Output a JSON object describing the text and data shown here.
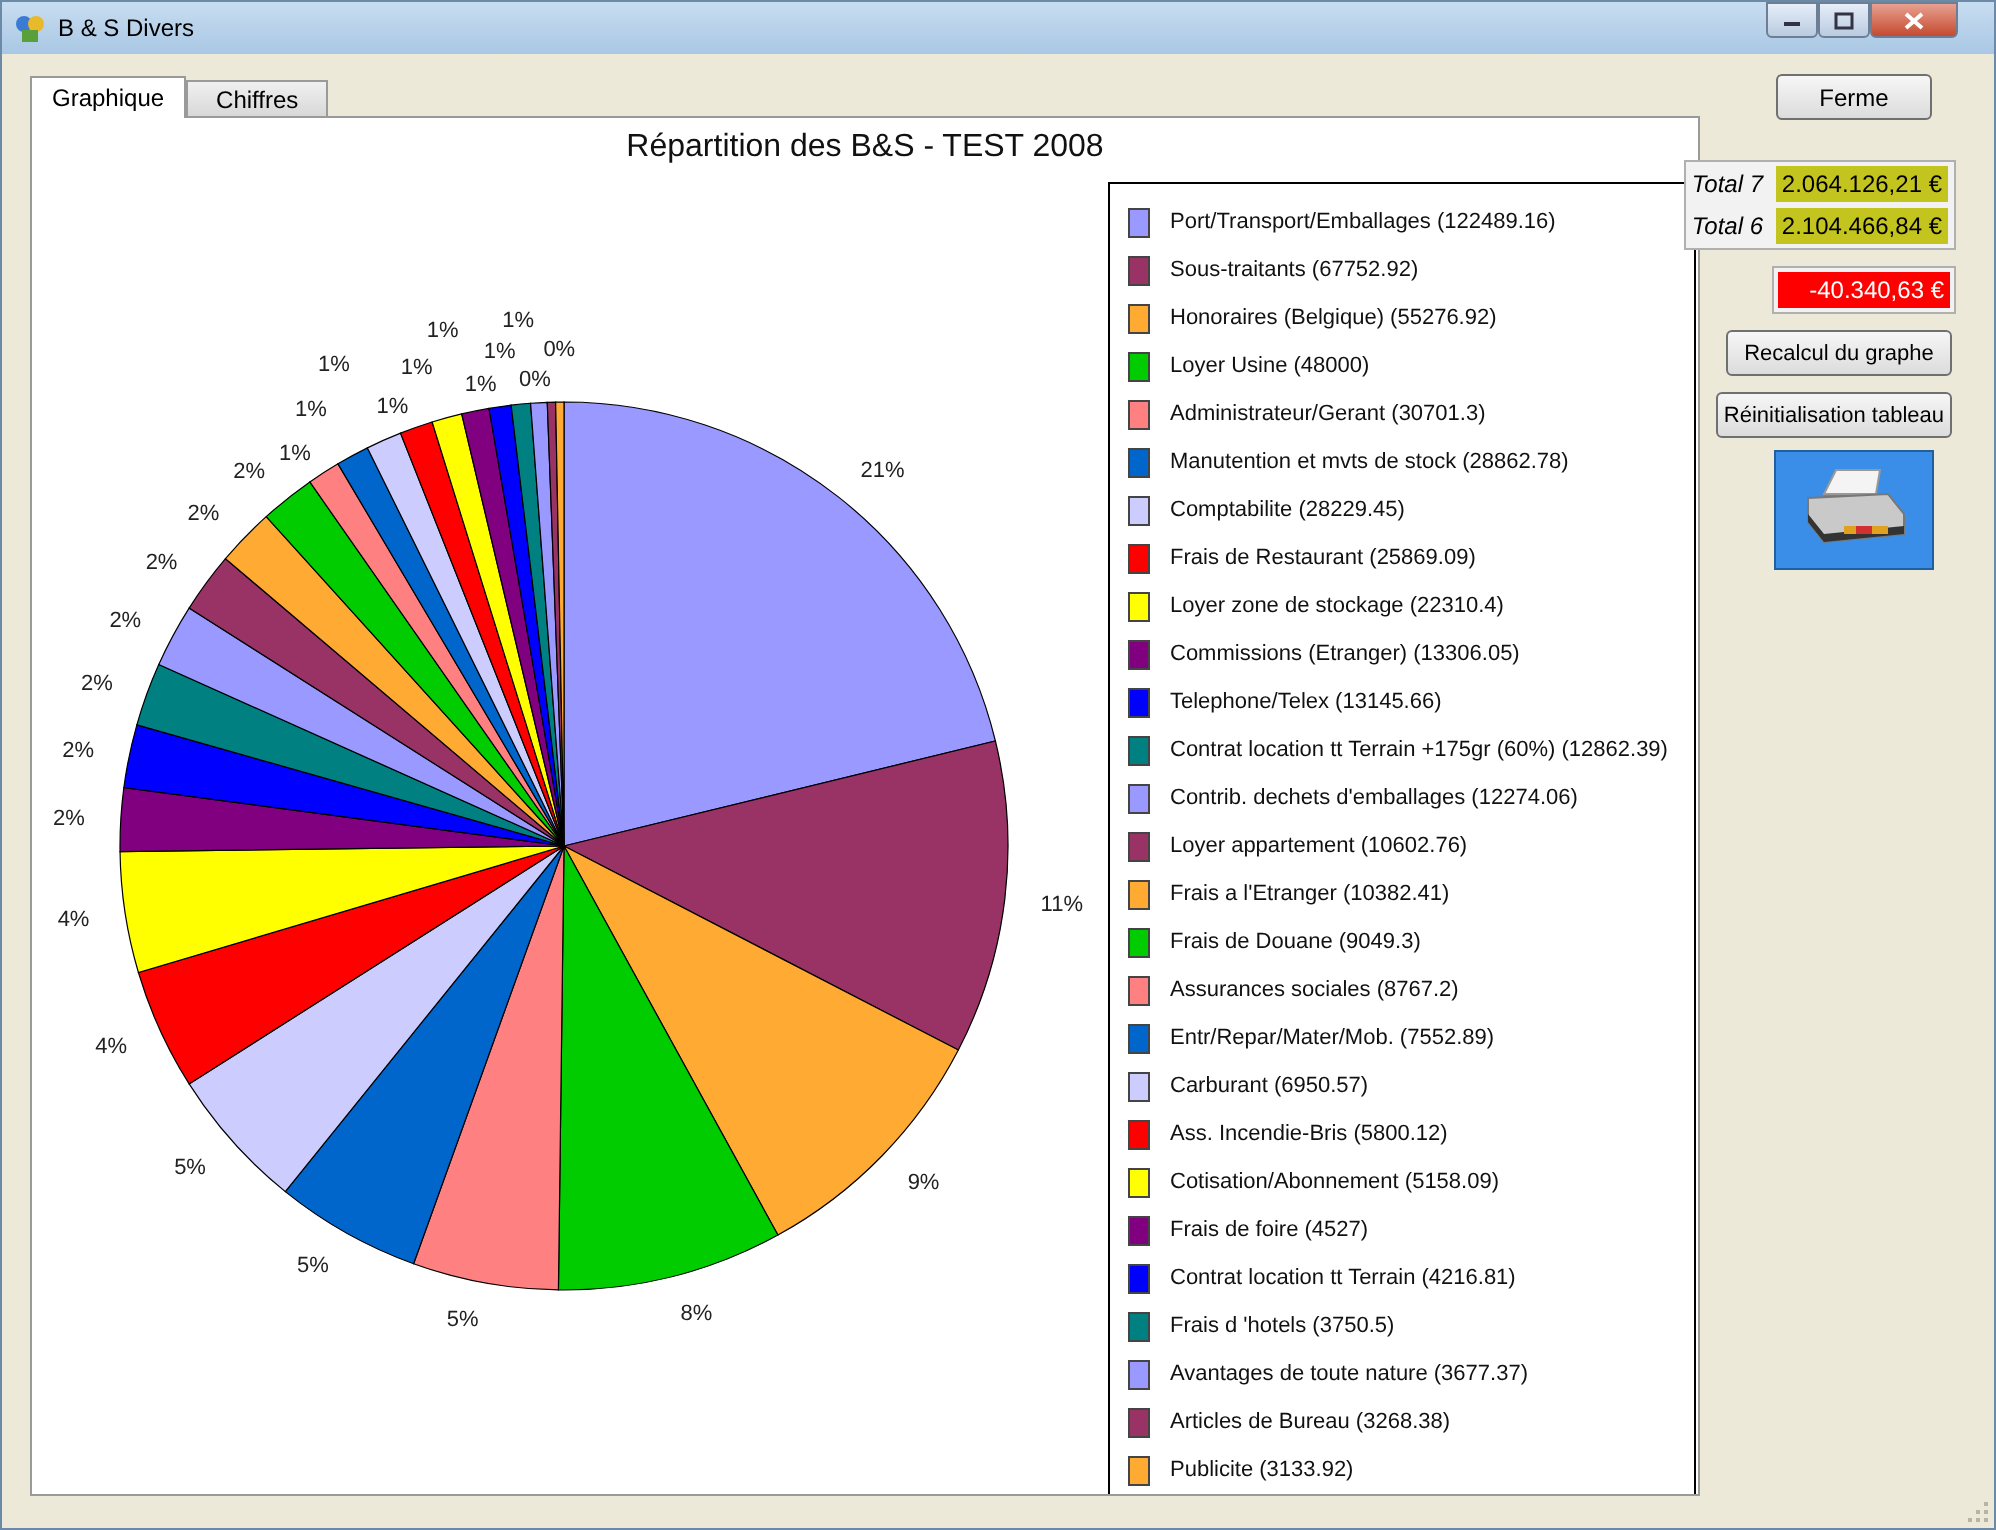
{
  "window": {
    "title": "B & S Divers"
  },
  "tabs": [
    {
      "label": "Graphique",
      "selected": true
    },
    {
      "label": "Chiffres",
      "selected": false
    }
  ],
  "chart_data": {
    "type": "pie",
    "title": "Répartition des B&S - TEST 2008",
    "categories": [
      "Port/Transport/Emballages (122489.16)",
      "Sous-traitants (67752.92)",
      "Honoraires (Belgique) (55276.92)",
      "Loyer Usine (48000)",
      "Administrateur/Gerant (30701.3)",
      "Manutention et mvts de stock (28862.78)",
      "Comptabilite (28229.45)",
      "Frais de Restaurant (25869.09)",
      "Loyer zone de stockage (22310.4)",
      "Commissions (Etranger) (13306.05)",
      "Telephone/Telex (13145.66)",
      "Contrat location tt Terrain +175gr (60%) (12862.39)",
      "Contrib. dechets d'emballages (12274.06)",
      "Loyer appartement (10602.76)",
      "Frais a l'Etranger (10382.41)",
      "Frais de Douane (9049.3)",
      "Assurances sociales (8767.2)",
      "Entr/Repar/Mater/Mob. (7552.89)",
      "Carburant (6950.57)",
      "Ass. Incendie-Bris (5800.12)",
      "Cotisation/Abonnement (5158.09)",
      "Frais de foire (4527)",
      "Contrat location tt Terrain (4216.81)",
      "Frais d 'hotels (3750.5)",
      "Avantages de toute nature (3677.37)",
      "Articles de Bureau (3268.38)",
      "Publicite (3133.92)"
    ],
    "values": [
      21.2,
      11.4,
      9.4,
      8.2,
      5.3,
      5.3,
      5.2,
      4.4,
      4.4,
      2.3,
      2.3,
      2.3,
      2.3,
      2.2,
      2.1,
      2.0,
      1.2,
      1.2,
      1.3,
      1.2,
      1.1,
      1.0,
      0.8,
      0.7,
      0.6,
      0.3,
      0.3
    ],
    "legend": "right",
    "colors": [
      "#9999ff",
      "#993366",
      "#ffaa33",
      "#00cc00",
      "#ff8080",
      "#0066cc",
      "#ccccff",
      "#ff0000",
      "#ffff00",
      "#800080",
      "#0000ff",
      "#008080",
      "#9999ff",
      "#993366",
      "#ffaa33",
      "#00cc00",
      "#ff8080",
      "#0066cc",
      "#ccccff",
      "#ff0000",
      "#ffff00",
      "#800080",
      "#0000ff",
      "#008080",
      "#9999ff",
      "#993366",
      "#ffaa33"
    ],
    "value_labels": [
      "21%",
      "11%",
      "9%",
      "8%",
      "5%",
      "5%",
      "5%",
      "4%",
      "4%",
      "2%",
      "2%",
      "2%",
      "2%",
      "2%",
      "2%",
      "2%",
      "1%",
      "1%",
      "1%",
      "1%",
      "1%",
      "1%",
      "1%",
      "1%",
      "1%",
      "0%",
      "0%"
    ]
  },
  "side_panel": {
    "close_button": "Ferme",
    "totals": [
      {
        "label": "Total 7",
        "value": "2.064.126,21 €"
      },
      {
        "label": "Total 6",
        "value": "2.104.466,84 €"
      }
    ],
    "difference": "-40.340,63 €",
    "buttons": [
      "Recalcul du graphe",
      "Réinitialisation tableau"
    ]
  }
}
